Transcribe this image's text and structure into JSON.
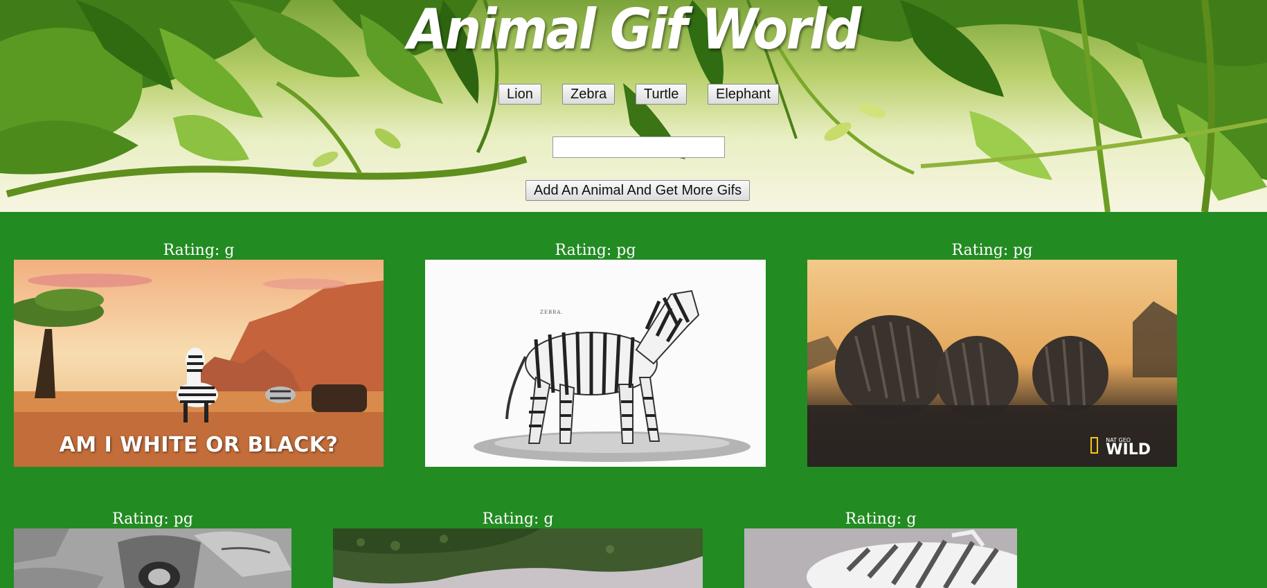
{
  "header": {
    "title": "Animal Gif World",
    "topic_buttons": [
      "Lion",
      "Zebra",
      "Turtle",
      "Elephant"
    ],
    "search_value": "",
    "add_button_label": "Add An Animal And Get More Gifs"
  },
  "gifs": [
    {
      "rating": "Rating: g",
      "caption": "AM I WHITE OR BLACK?"
    },
    {
      "rating": "Rating: pg",
      "engraving_label": "ZEBRA."
    },
    {
      "rating": "Rating: pg",
      "watermark_small": "NAT GEO",
      "watermark_large": "WILD"
    },
    {
      "rating": "Rating: pg"
    },
    {
      "rating": "Rating: g"
    },
    {
      "rating": "Rating: g"
    }
  ],
  "colors": {
    "background": "#228b22",
    "text": "#ffffff"
  }
}
